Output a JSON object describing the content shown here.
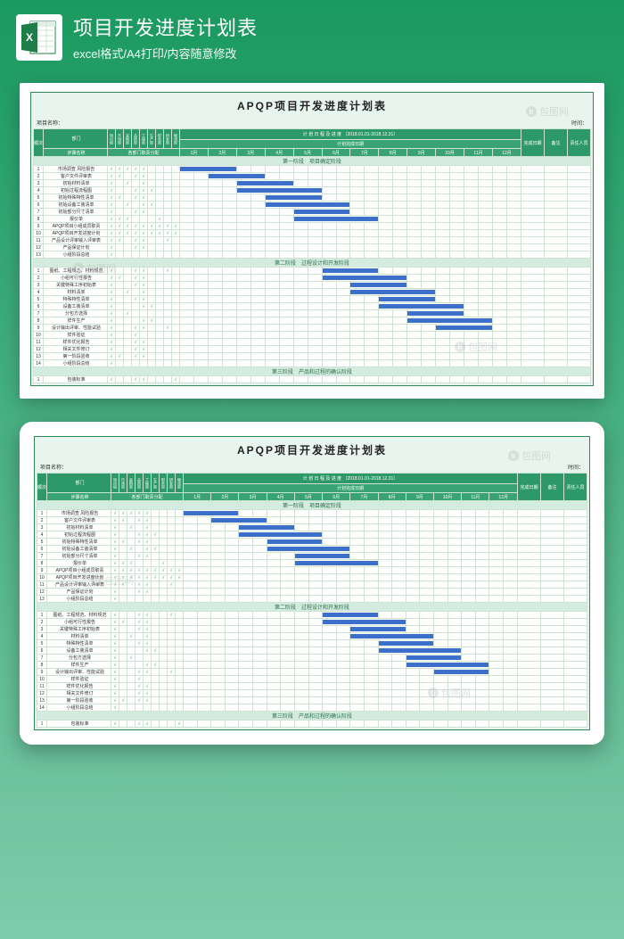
{
  "header": {
    "title": "项目开发进度计划表",
    "subtitle": "excel格式/A4打印/内容随意修改"
  },
  "watermark": "包图网",
  "doc": {
    "title": "APQP项目开发进度计划表",
    "meta_left": "项目名称：",
    "meta_right": "时间：",
    "section_dept": "部门",
    "section_step": "步骤名称",
    "section_dept_assign": "各部门职责分配",
    "plan_period_label": "计 划 日 程 及 进 度 （2018.01.01-2018.12.31）",
    "plan_date_label": "计划完成日期",
    "col_done": "完成日期",
    "col_remark": "备注",
    "col_owner": "责任人员",
    "depts": [
      "项目组",
      "市场部",
      "采购部",
      "品质部",
      "工程部",
      "生产部",
      "财务部",
      "研发部",
      "物流部"
    ],
    "months": [
      "1月",
      "2月",
      "3月",
      "4月",
      "5月",
      "6月",
      "7月",
      "8月",
      "9月",
      "10月",
      "11月",
      "12月"
    ],
    "phase1_title": "第一阶段　项目确定阶段",
    "phase2_title": "第二阶段　过程设计和开发阶段",
    "phase3_title": "第三阶段　产品和过程的确认阶段",
    "phase1_rows": [
      {
        "n": "1",
        "name": "市场调查 风险报告",
        "checks": [
          1,
          1,
          1,
          1,
          1,
          0,
          0,
          0,
          0
        ],
        "bar": [
          0,
          2
        ]
      },
      {
        "n": "2",
        "name": "客户文件评审表",
        "checks": [
          1,
          1,
          0,
          1,
          1,
          0,
          0,
          0,
          0
        ],
        "bar": [
          1,
          3
        ]
      },
      {
        "n": "3",
        "name": "初始材料清单",
        "checks": [
          1,
          0,
          1,
          0,
          1,
          0,
          0,
          0,
          0
        ],
        "bar": [
          2,
          4
        ]
      },
      {
        "n": "4",
        "name": "初始过程流程图",
        "checks": [
          1,
          0,
          0,
          1,
          1,
          1,
          0,
          0,
          0
        ],
        "bar": [
          2,
          5
        ]
      },
      {
        "n": "5",
        "name": "初始特殊特性清单",
        "checks": [
          1,
          1,
          0,
          1,
          1,
          0,
          0,
          0,
          0
        ],
        "bar": [
          3,
          5
        ]
      },
      {
        "n": "6",
        "name": "初始设备工装清单",
        "checks": [
          1,
          0,
          1,
          0,
          1,
          1,
          0,
          0,
          0
        ],
        "bar": [
          3,
          6
        ]
      },
      {
        "n": "7",
        "name": "初始部分尺寸清单",
        "checks": [
          1,
          0,
          0,
          1,
          1,
          0,
          0,
          0,
          0
        ],
        "bar": [
          4,
          6
        ]
      },
      {
        "n": "8",
        "name": "报价单",
        "checks": [
          1,
          1,
          1,
          0,
          0,
          0,
          1,
          0,
          0
        ],
        "bar": [
          4,
          7
        ]
      },
      {
        "n": "9",
        "name": "APQP项目小组成员职责",
        "checks": [
          1,
          1,
          1,
          1,
          1,
          1,
          1,
          1,
          1
        ],
        "bar": [
          0,
          0
        ]
      },
      {
        "n": "10",
        "name": "APQP项目开发进度计划",
        "checks": [
          1,
          1,
          1,
          1,
          1,
          1,
          1,
          1,
          1
        ],
        "bar": [
          0,
          0
        ]
      },
      {
        "n": "11",
        "name": "产品设计评审输入评审表",
        "checks": [
          1,
          1,
          0,
          1,
          1,
          0,
          0,
          1,
          0
        ],
        "bar": [
          0,
          0
        ]
      },
      {
        "n": "12",
        "name": "产品保证计划",
        "checks": [
          1,
          0,
          0,
          1,
          1,
          0,
          0,
          0,
          0
        ],
        "bar": [
          0,
          0
        ]
      },
      {
        "n": "13",
        "name": "小组阶段总结",
        "checks": [
          1,
          0,
          0,
          0,
          0,
          0,
          0,
          0,
          0
        ],
        "bar": [
          0,
          0
        ]
      }
    ],
    "phase2_rows": [
      {
        "n": "1",
        "name": "图纸、工程规范、材料规范",
        "checks": [
          1,
          0,
          0,
          1,
          1,
          0,
          0,
          1,
          0
        ],
        "bar": [
          5,
          7
        ]
      },
      {
        "n": "2",
        "name": "小组可行性报告",
        "checks": [
          1,
          1,
          0,
          1,
          1,
          0,
          0,
          0,
          0
        ],
        "bar": [
          5,
          8
        ]
      },
      {
        "n": "3",
        "name": "关键特殊工序初始表",
        "checks": [
          1,
          0,
          0,
          1,
          1,
          0,
          0,
          0,
          0
        ],
        "bar": [
          6,
          8
        ]
      },
      {
        "n": "4",
        "name": "材料清单",
        "checks": [
          1,
          0,
          1,
          0,
          1,
          0,
          0,
          0,
          0
        ],
        "bar": [
          6,
          9
        ]
      },
      {
        "n": "5",
        "name": "特殊特性清单",
        "checks": [
          1,
          0,
          0,
          1,
          1,
          0,
          0,
          0,
          0
        ],
        "bar": [
          7,
          9
        ]
      },
      {
        "n": "6",
        "name": "设备工装清单",
        "checks": [
          1,
          0,
          0,
          0,
          1,
          1,
          0,
          0,
          0
        ],
        "bar": [
          7,
          10
        ]
      },
      {
        "n": "7",
        "name": "分包方选择",
        "checks": [
          1,
          0,
          1,
          0,
          0,
          0,
          0,
          0,
          0
        ],
        "bar": [
          8,
          10
        ]
      },
      {
        "n": "8",
        "name": "样件生产",
        "checks": [
          1,
          0,
          0,
          0,
          1,
          1,
          0,
          0,
          0
        ],
        "bar": [
          8,
          11
        ]
      },
      {
        "n": "9",
        "name": "设计输出评审、性能试验",
        "checks": [
          1,
          0,
          0,
          1,
          1,
          0,
          0,
          1,
          0
        ],
        "bar": [
          9,
          11
        ]
      },
      {
        "n": "10",
        "name": "样件验证",
        "checks": [
          1,
          0,
          0,
          1,
          0,
          0,
          0,
          0,
          0
        ],
        "bar": [
          0,
          0
        ]
      },
      {
        "n": "11",
        "name": "样件优化报告",
        "checks": [
          1,
          0,
          0,
          1,
          1,
          0,
          0,
          0,
          0
        ],
        "bar": [
          0,
          0
        ]
      },
      {
        "n": "12",
        "name": "相关文件修订",
        "checks": [
          1,
          0,
          0,
          1,
          1,
          0,
          0,
          0,
          0
        ],
        "bar": [
          0,
          0
        ]
      },
      {
        "n": "13",
        "name": "第一阶段验收",
        "checks": [
          1,
          1,
          0,
          1,
          1,
          0,
          0,
          0,
          0
        ],
        "bar": [
          0,
          0
        ]
      },
      {
        "n": "14",
        "name": "小组阶段总结",
        "checks": [
          1,
          0,
          0,
          0,
          0,
          0,
          0,
          0,
          0
        ],
        "bar": [
          0,
          0
        ]
      }
    ],
    "phase3_rows": [
      {
        "n": "1",
        "name": "包装标准",
        "checks": [
          1,
          0,
          0,
          1,
          1,
          0,
          0,
          0,
          1
        ],
        "bar": [
          0,
          0
        ]
      }
    ]
  }
}
